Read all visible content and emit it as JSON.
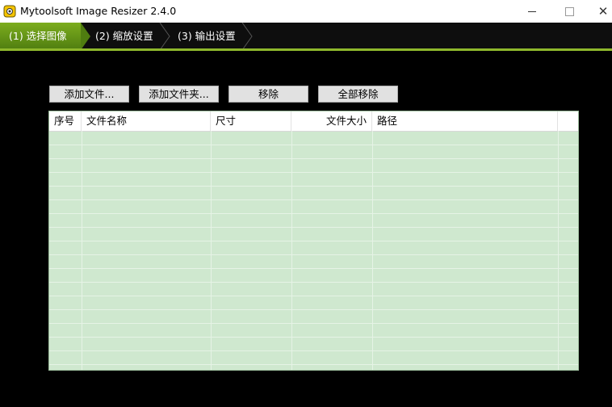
{
  "window": {
    "title": "Mytoolsoft Image Resizer 2.4.0",
    "minimize_glyph": "—",
    "close_glyph": "✕"
  },
  "steps": [
    {
      "label": "(1) 选择图像",
      "active": true
    },
    {
      "label": "(2) 缩放设置",
      "active": false
    },
    {
      "label": "(3) 输出设置",
      "active": false
    }
  ],
  "toolbar": {
    "add_file": "添加文件...",
    "add_folder": "添加文件夹...",
    "remove": "移除",
    "remove_all": "全部移除"
  },
  "file_list": {
    "columns": [
      "序号",
      "文件名称",
      "尺寸",
      "文件大小",
      "路径"
    ],
    "rows": []
  },
  "colors": {
    "active_step": "#6a9e18",
    "list_background": "#cfe8cf",
    "window_background": "#000000"
  }
}
